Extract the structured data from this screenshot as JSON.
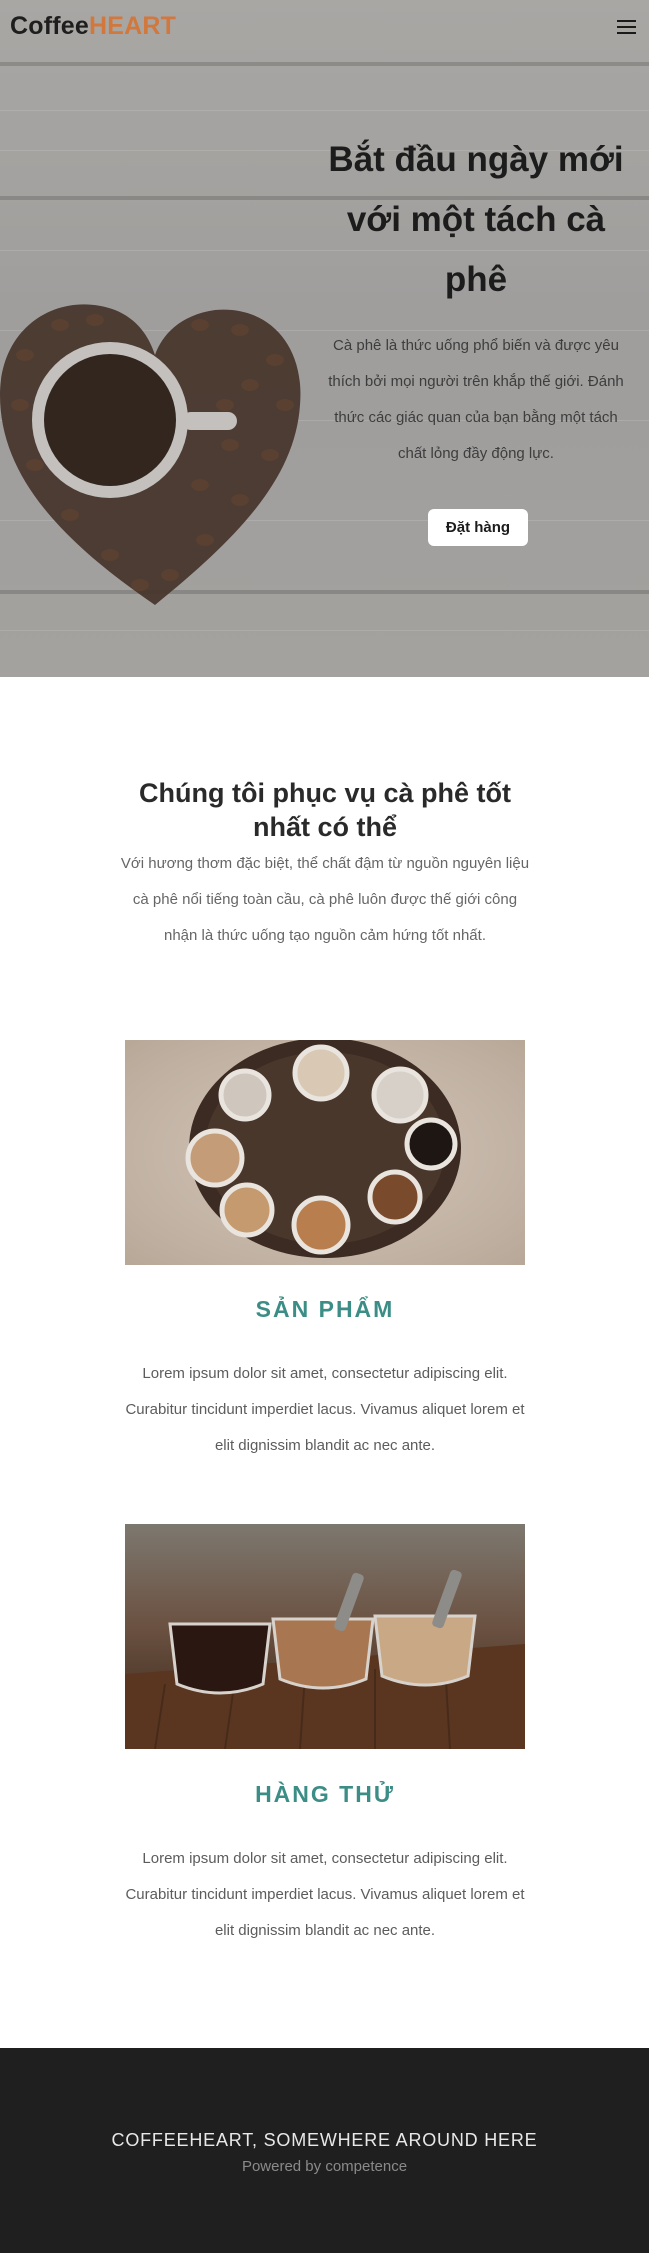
{
  "nav": {
    "brand_part1": "Coffee",
    "brand_part2": "HEART",
    "menu_icon": "hamburger-icon"
  },
  "hero": {
    "title": "Bắt đầu ngày mới với một tách cà phê",
    "description": "Cà phê là thức uống phổ biến và được yêu thích bởi mọi người trên khắp thế giới. Đánh thức các giác quan của bạn bằng một tách chất lỏng đầy động lực.",
    "cta_label": "Đặt hàng"
  },
  "intro": {
    "title": "Chúng tôi phục vụ cà phê tốt nhất có thể",
    "text": "Với hương thơm đặc biệt, thể chất đậm từ nguồn nguyên liệu cà phê nổi tiếng toàn cầu, cà phê luôn được thế giới công nhận là thức uống tạo nguồn cảm hứng tốt nhất."
  },
  "features": [
    {
      "title": "SẢN PHẨM",
      "text": "Lorem ipsum dolor sit amet, consectetur adipiscing elit. Curabitur tincidunt imperdiet lacus. Vivamus aliquet lorem et elit dignissim blandit ac nec ante."
    },
    {
      "title": "HÀNG THỬ",
      "text": "Lorem ipsum dolor sit amet, consectetur adipiscing elit. Curabitur tincidunt imperdiet lacus. Vivamus aliquet lorem et elit dignissim blandit ac nec ante."
    }
  ],
  "footer": {
    "title": "COFFEEHEART, SOMEWHERE AROUND HERE",
    "subtitle": "Powered by competence"
  },
  "colors": {
    "brand_accent": "#d2783c",
    "heading_teal": "#3b8d86",
    "footer_bg": "#1f1f1f"
  }
}
